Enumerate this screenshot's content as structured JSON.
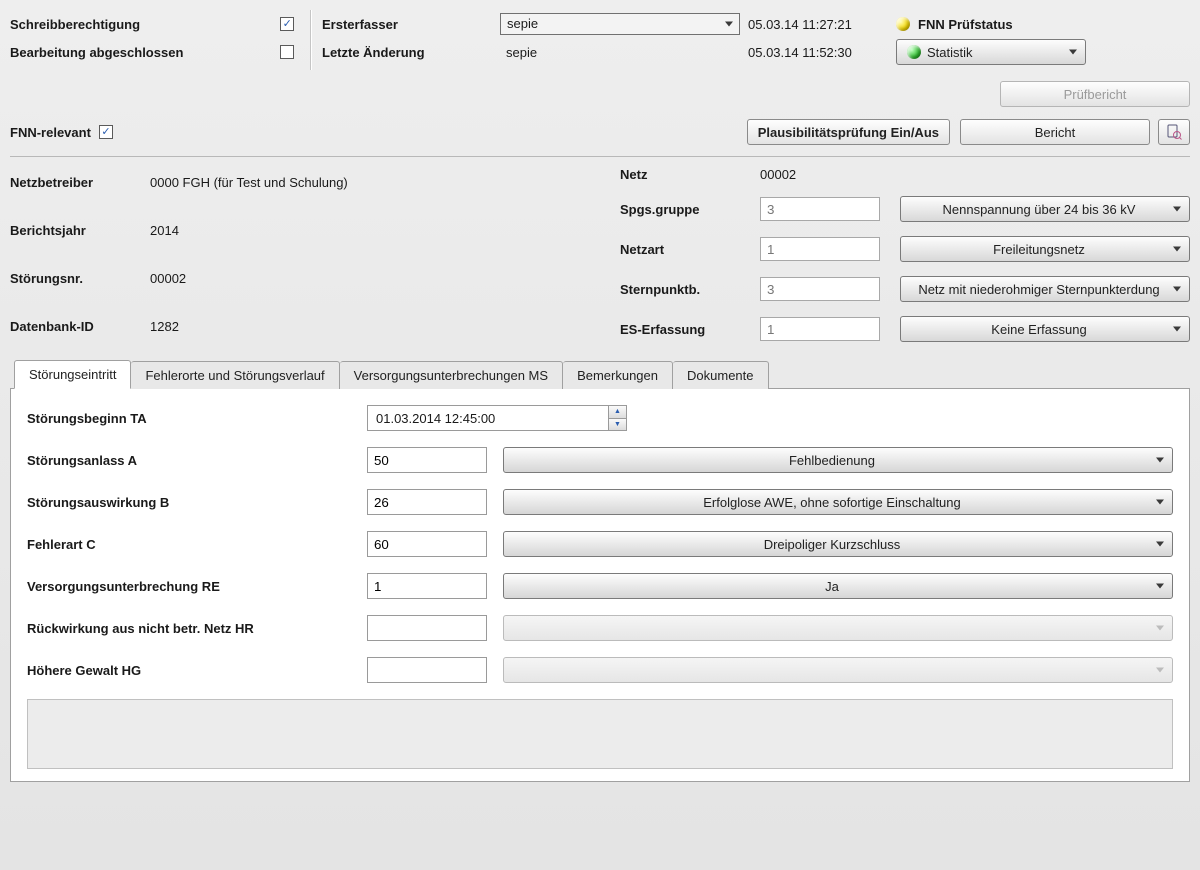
{
  "header": {
    "write_permission_label": "Schreibberechtigung",
    "write_permission_checked": true,
    "editing_done_label": "Bearbeitung abgeschlossen",
    "editing_done_checked": false,
    "first_author_label": "Ersterfasser",
    "first_author_value": "sepie",
    "first_author_ts": "05.03.14 11:27:21",
    "last_change_label": "Letzte Änderung",
    "last_change_value": "sepie",
    "last_change_ts": "05.03.14 11:52:30",
    "fnn_status_label": "FNN Prüfstatus",
    "statistic_label": "Statistik",
    "pruefbericht_label": "Prüfbericht",
    "fnn_relevant_label": "FNN-relevant",
    "fnn_relevant_checked": true,
    "plausi_btn": "Plausibilitätsprüfung Ein/Aus",
    "bericht_btn": "Bericht"
  },
  "info": {
    "netzbetreiber_label": "Netzbetreiber",
    "netzbetreiber_value": "0000  FGH (für Test und Schulung)",
    "berichtsjahr_label": "Berichtsjahr",
    "berichtsjahr_value": "2014",
    "stoerungsnr_label": "Störungsnr.",
    "stoerungsnr_value": "00002",
    "datenbank_id_label": "Datenbank-ID",
    "datenbank_id_value": "1282",
    "netz_label": "Netz",
    "netz_value": "00002",
    "spgs_label": "Spgs.gruppe",
    "spgs_code": "3",
    "spgs_sel": "Nennspannung über 24 bis 36 kV",
    "netzart_label": "Netzart",
    "netzart_code": "1",
    "netzart_sel": "Freileitungsnetz",
    "sternpunkt_label": "Sternpunktb.",
    "sternpunkt_code": "3",
    "sternpunkt_sel": "Netz mit niederohmiger Sternpunkterdung",
    "es_label": "ES-Erfassung",
    "es_code": "1",
    "es_sel": "Keine Erfassung"
  },
  "tabs": [
    "Störungseintritt",
    "Fehlerorte und Störungsverlauf",
    "Versorgungsunterbrechungen MS",
    "Bemerkungen",
    "Dokumente"
  ],
  "form": {
    "stoerungsbeginn_label": "Störungsbeginn TA",
    "stoerungsbeginn_value": "01.03.2014 12:45:00",
    "anlass_label": "Störungsanlass A",
    "anlass_code": "50",
    "anlass_sel": "Fehlbedienung",
    "auswirkung_label": "Störungsauswirkung B",
    "auswirkung_code": "26",
    "auswirkung_sel": "Erfolglose AWE, ohne sofortige Einschaltung",
    "fehlerart_label": "Fehlerart C",
    "fehlerart_code": "60",
    "fehlerart_sel": "Dreipoliger Kurzschluss",
    "vu_label": "Versorgungsunterbrechung RE",
    "vu_code": "1",
    "vu_sel": "Ja",
    "rueckwirkung_label": "Rückwirkung aus nicht betr. Netz HR",
    "rueckwirkung_code": "",
    "rueckwirkung_sel": "",
    "hg_label": "Höhere Gewalt HG",
    "hg_code": "",
    "hg_sel": ""
  }
}
